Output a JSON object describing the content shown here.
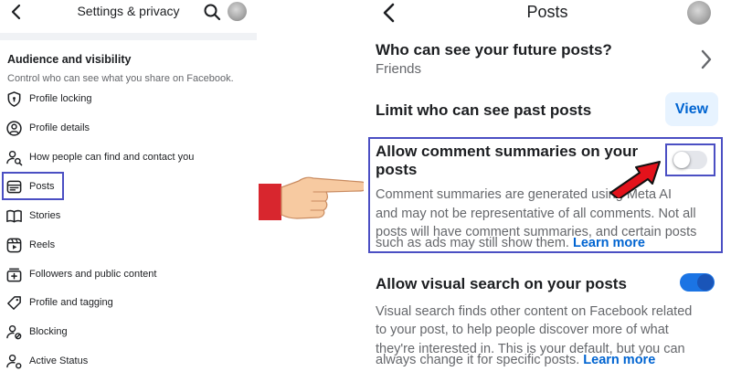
{
  "left": {
    "header": {
      "title": "Settings & privacy"
    },
    "section": {
      "title": "Audience and visibility",
      "description": "Control who can see what you share on Facebook."
    },
    "items": [
      {
        "label": "Profile locking",
        "icon": "shield-lock-icon"
      },
      {
        "label": "Profile details",
        "icon": "user-circle-icon"
      },
      {
        "label": "How people can find and contact you",
        "icon": "user-search-icon"
      },
      {
        "label": "Posts",
        "icon": "posts-card-icon"
      },
      {
        "label": "Stories",
        "icon": "book-open-icon"
      },
      {
        "label": "Reels",
        "icon": "reels-play-icon"
      },
      {
        "label": "Followers and public content",
        "icon": "add-box-icon"
      },
      {
        "label": "Profile and tagging",
        "icon": "tag-icon"
      },
      {
        "label": "Blocking",
        "icon": "user-block-icon"
      },
      {
        "label": "Active Status",
        "icon": "user-active-icon"
      }
    ],
    "highlighted_item": "Posts"
  },
  "right": {
    "header": {
      "title": "Posts"
    },
    "future_posts": {
      "title": "Who can see your future posts?",
      "value": "Friends"
    },
    "limit_past": {
      "title": "Limit who can see past posts",
      "button": "View"
    },
    "comment_summaries": {
      "title_line1": "Allow comment summaries on your",
      "title_line2": "posts",
      "desc_line1": "Comment summaries are generated using Meta AI",
      "desc_line2": "and may not be representative of all comments. Not all",
      "desc_line3": "posts will have comment summaries, and certain posts",
      "desc_line4": "such as ads may still show them.",
      "learn_more": "Learn more",
      "enabled": false
    },
    "visual_search": {
      "title": "Allow visual search on your posts",
      "desc_line1": "Visual search finds other content on Facebook related",
      "desc_line2": "to your post, to help people discover more of what",
      "desc_line3": "they're interested in. This is your default, but you can",
      "desc_line4": "always change it for specific posts.",
      "learn_more": "Learn more",
      "enabled": true
    }
  },
  "colors": {
    "highlight_border": "#4b4fc3",
    "link_blue": "#0064d1",
    "toggle_on": "#1b74e4",
    "arrow_red": "#e3121b",
    "cuff_red": "#d8262e"
  }
}
